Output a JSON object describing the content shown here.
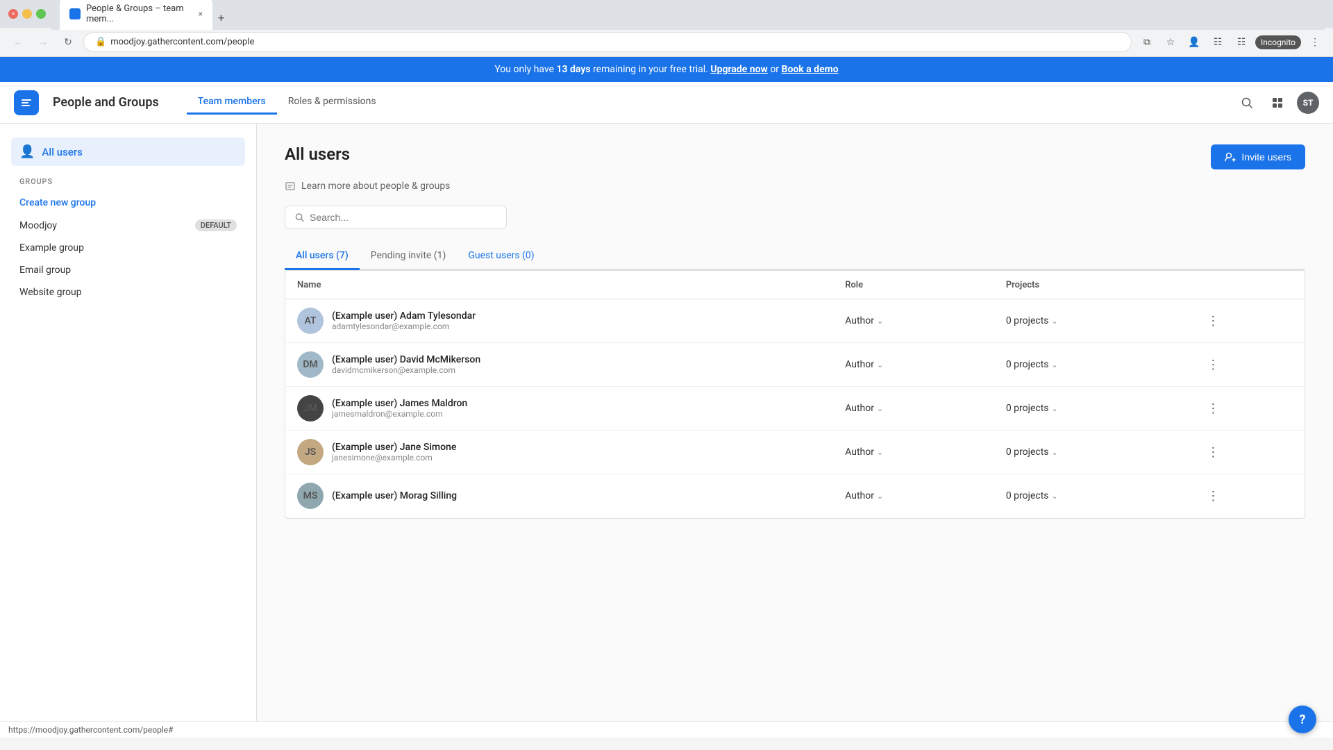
{
  "browser": {
    "tab_title": "People & Groups – team mem...",
    "tab_favicon": "gc",
    "close_label": "×",
    "new_tab_label": "+",
    "url": "moodjoy.gathercontent.com/people",
    "back_disabled": false,
    "forward_disabled": true,
    "incognito_label": "Incognito",
    "status_url": "https://moodjoy.gathercontent.com/people#"
  },
  "trial_banner": {
    "text_before": "You only have ",
    "days": "13 days",
    "text_middle": " remaining in your free trial. ",
    "upgrade_label": "Upgrade now",
    "text_or": " or ",
    "demo_label": "Book a demo"
  },
  "header": {
    "logo_text": "gc",
    "title": "People and Groups",
    "nav": [
      {
        "label": "Team members",
        "active": true
      },
      {
        "label": "Roles & permissions",
        "active": false
      }
    ],
    "user_initials": "ST"
  },
  "sidebar": {
    "all_users_label": "All users",
    "groups_section_label": "GROUPS",
    "create_group_label": "Create new group",
    "groups": [
      {
        "name": "Moodjoy",
        "badge": "DEFAULT"
      },
      {
        "name": "Example group",
        "badge": null
      },
      {
        "name": "Email group",
        "badge": null
      },
      {
        "name": "Website group",
        "badge": null
      }
    ]
  },
  "main": {
    "page_title": "All users",
    "invite_btn_label": "Invite users",
    "learn_more_label": "Learn more about people & groups",
    "search_placeholder": "Search...",
    "tabs": [
      {
        "label": "All users (7)",
        "active": true
      },
      {
        "label": "Pending invite (1)",
        "active": false
      },
      {
        "label": "Guest users (0)",
        "active": false
      }
    ],
    "table": {
      "columns": [
        "Name",
        "Role",
        "Projects"
      ],
      "rows": [
        {
          "name": "(Example user) Adam Tylesondar",
          "email": "adamtylesondar@example.com",
          "role": "Author",
          "projects": "0 projects",
          "avatar_initials": "AT",
          "avatar_class": "avatar-adam"
        },
        {
          "name": "(Example user) David McMikerson",
          "email": "davidmcmikerson@example.com",
          "role": "Author",
          "projects": "0 projects",
          "avatar_initials": "DM",
          "avatar_class": "avatar-david"
        },
        {
          "name": "(Example user) James Maldron",
          "email": "jamesmaldron@example.com",
          "role": "Author",
          "projects": "0 projects",
          "avatar_initials": "JM",
          "avatar_class": "avatar-james"
        },
        {
          "name": "(Example user) Jane Simone",
          "email": "janesimone@example.com",
          "role": "Author",
          "projects": "0 projects",
          "avatar_initials": "JS",
          "avatar_class": "avatar-jane"
        },
        {
          "name": "(Example user) Morag Silling",
          "email": "",
          "role": "Author",
          "projects": "0 projects",
          "avatar_initials": "MS",
          "avatar_class": "avatar-morag"
        }
      ]
    }
  },
  "help_btn_label": "?"
}
